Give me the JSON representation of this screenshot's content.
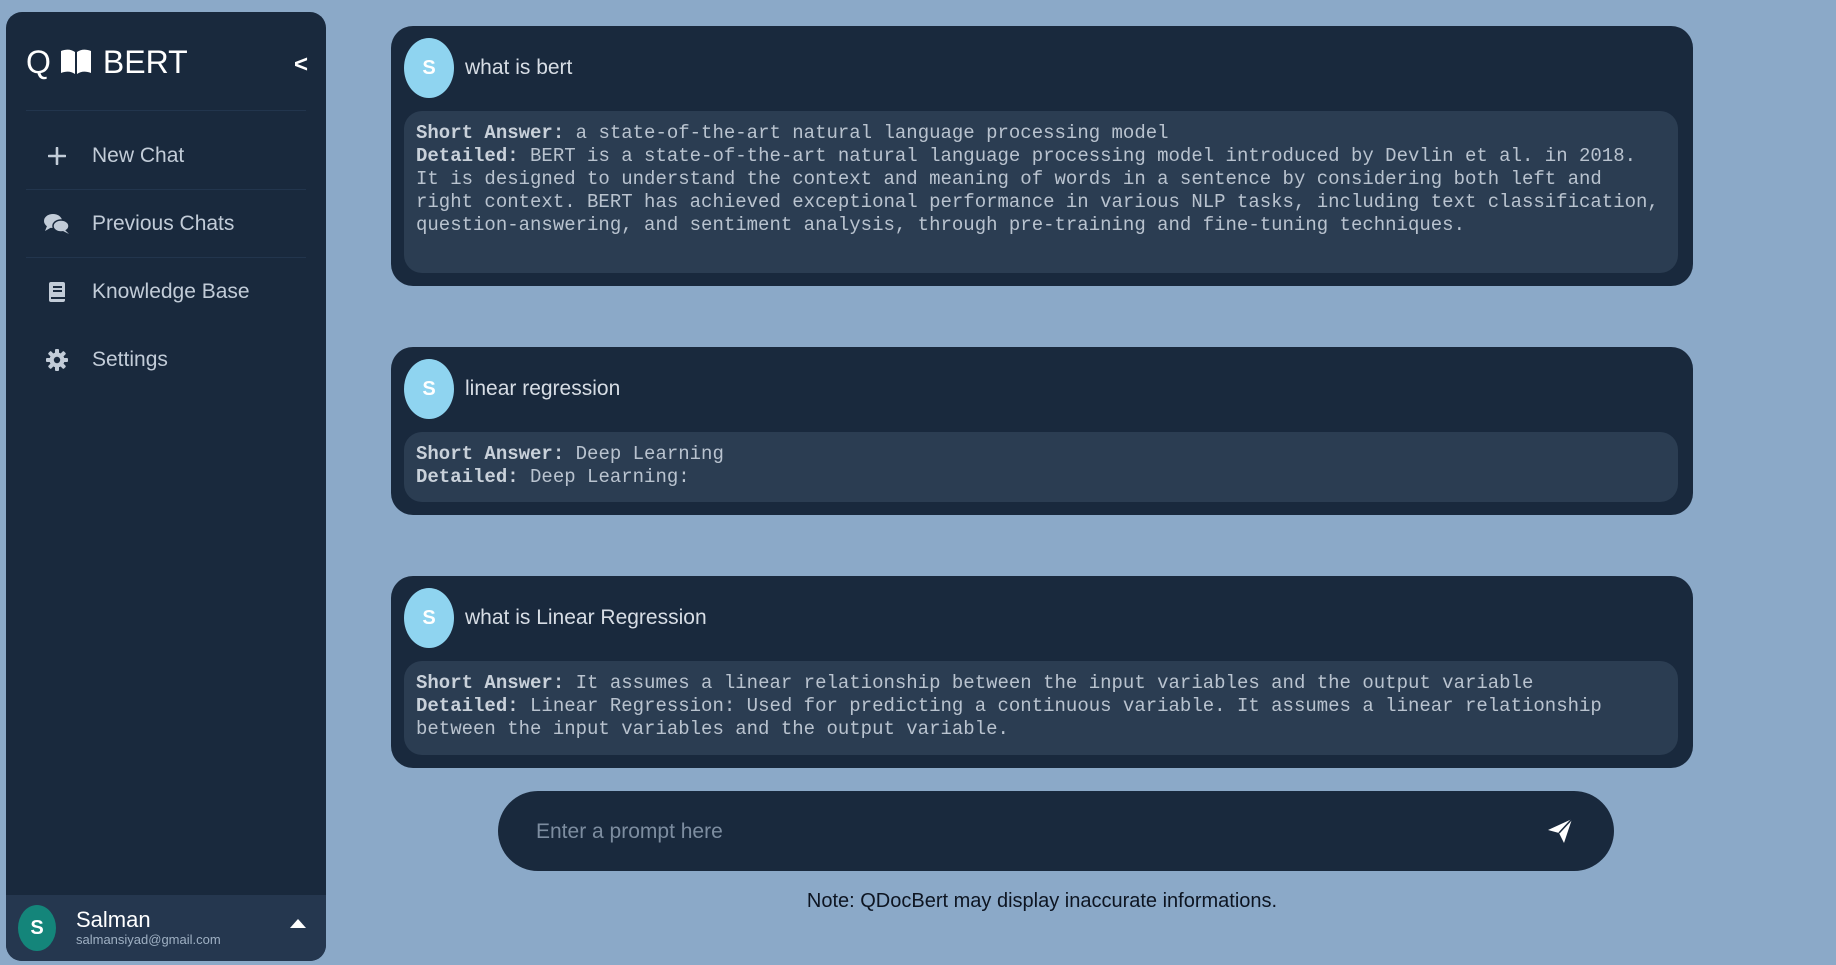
{
  "sidebar": {
    "brand": {
      "prefix": "Q",
      "name": "BERT",
      "book_icon": "open-book-icon"
    },
    "collapse_label": "<",
    "nav": [
      {
        "label": "New Chat",
        "icon": "plus-icon"
      },
      {
        "label": "Previous Chats",
        "icon": "chat-bubbles-icon"
      },
      {
        "label": "Knowledge Base",
        "icon": "book-icon"
      },
      {
        "label": "Settings",
        "icon": "gear-icon"
      }
    ],
    "user": {
      "initial": "S",
      "name": "Salman",
      "email": "salmansiyad@gmail.com"
    }
  },
  "chats": [
    {
      "initial": "S",
      "question": "what is bert",
      "short_label": "Short Answer:",
      "short_answer": " a state-of-the-art natural language processing model",
      "detailed_label": "Detailed:",
      "detailed_answer": " BERT is a state-of-the-art natural language processing model introduced by Devlin et al. in 2018. It is designed to understand the context and meaning of words in a sentence by considering both left and right context. BERT has achieved exceptional performance in various NLP tasks, including text classification, question-answering, and sentiment analysis, through pre-training and fine-tuning techniques."
    },
    {
      "initial": "S",
      "question": "linear regression",
      "short_label": "Short Answer:",
      "short_answer": " Deep Learning",
      "detailed_label": "Detailed:",
      "detailed_answer": " Deep Learning:"
    },
    {
      "initial": "S",
      "question": "what is Linear Regression",
      "short_label": "Short Answer:",
      "short_answer": " It assumes a linear relationship between the input variables and the output variable",
      "detailed_label": "Detailed:",
      "detailed_answer": " Linear Regression: Used for predicting a continuous variable. It assumes a linear relationship between the input variables and the output variable."
    }
  ],
  "prompt": {
    "placeholder": "Enter a prompt here",
    "value": "",
    "send_icon": "send-icon"
  },
  "note": "Note: QDocBert may display inaccurate informations.",
  "colors": {
    "page_bg": "#8ba9c8",
    "panel_bg": "#19293d",
    "answer_bg": "#2b3d52",
    "avatar_bg": "#8fd4f0",
    "user_avatar_bg": "#14857a"
  }
}
